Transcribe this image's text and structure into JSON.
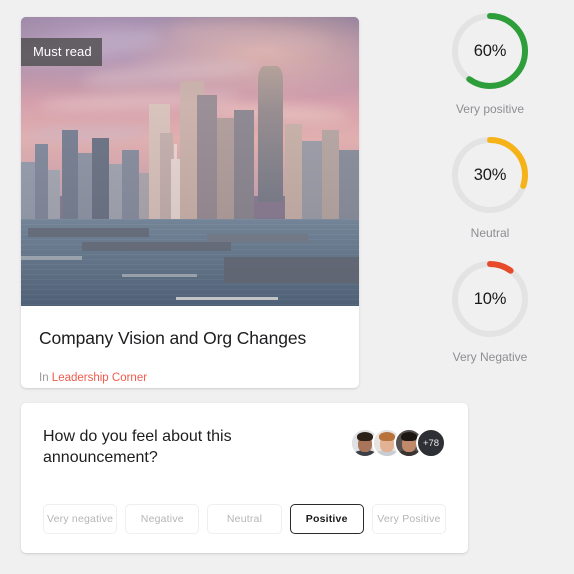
{
  "article": {
    "badge": "Must read",
    "title": "Company Vision and Org Changes",
    "meta_prefix": "In",
    "space_name": "Leadership Corner",
    "hero_alt": "city-skyline-at-sunset-photo",
    "link_color": "#ef5b4c"
  },
  "sentiment": {
    "gauges": [
      {
        "value": 60,
        "value_label": "60%",
        "label": "Very positive",
        "color": "#2e9e3a"
      },
      {
        "value": 30,
        "value_label": "30%",
        "label": "Neutral",
        "color": "#f5b317"
      },
      {
        "value": 10,
        "value_label": "10%",
        "label": "Very Negative",
        "color": "#e8492b"
      }
    ],
    "track_color": "#e3e3e4"
  },
  "poll": {
    "question": "How do you feel about this announcement?",
    "participants": {
      "overflow_label": "+78",
      "avatars": [
        {
          "name": "participant-avatar-1"
        },
        {
          "name": "participant-avatar-2"
        },
        {
          "name": "participant-avatar-3"
        }
      ]
    },
    "options": [
      {
        "label": "Very negative",
        "selected": false
      },
      {
        "label": "Negative",
        "selected": false
      },
      {
        "label": "Neutral",
        "selected": false
      },
      {
        "label": "Positive",
        "selected": true
      },
      {
        "label": "Very Positive",
        "selected": false
      }
    ]
  }
}
